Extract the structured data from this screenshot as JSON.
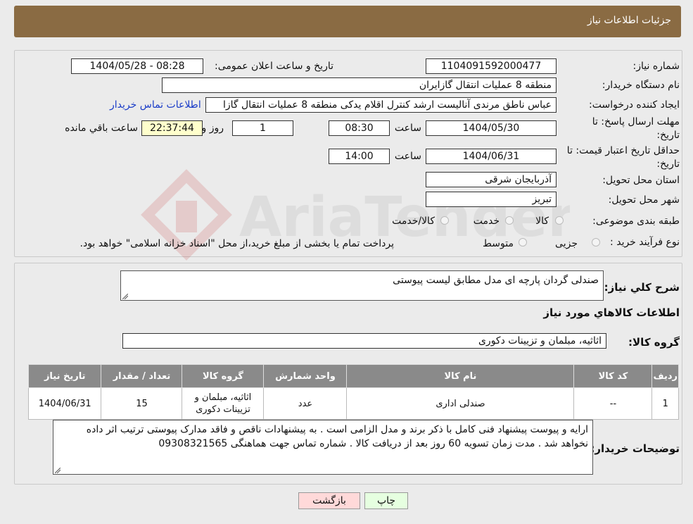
{
  "header": {
    "title": "جزئیات اطلاعات نیاز"
  },
  "fields": {
    "need_number_label": "شماره نیاز:",
    "need_number": "1104091592000477",
    "announce_label": "تاریخ و ساعت اعلان عمومی:",
    "announce_value": "1404/05/28 - 08:28",
    "buyer_org_label": "نام دستگاه خریدار:",
    "buyer_org": "منطقه 8 عملیات انتقال گازایران",
    "creator_label": "ایجاد کننده درخواست:",
    "creator": "عباس ناطق مرندی آنالیست ارشد کنترل اقلام یدکی منطقه 8 عملیات انتقال گازا",
    "contact_link": "اطلاعات تماس خریدار",
    "deadline_label_1": "مهلت ارسال پاسخ: تا",
    "deadline_label_2": "تاریخ:",
    "deadline_date": "1404/05/30",
    "time_word": "ساعت",
    "deadline_time": "08:30",
    "days_value": "1",
    "days_word": "روز و",
    "remaining_time": "22:37:44",
    "remaining_word": "ساعت باقي مانده",
    "validity_label_1": "حداقل تاریخ اعتبار قیمت: تا",
    "validity_label_2": "تاریخ:",
    "validity_date": "1404/06/31",
    "validity_time": "14:00",
    "province_label": "استان محل تحویل:",
    "province": "آذربایجان شرقی",
    "city_label": "شهر محل تحویل:",
    "city": "تبریز",
    "category_label": "طبقه بندی موضوعی:",
    "category_options": [
      "کالا",
      "خدمت",
      "کالا/خدمت"
    ],
    "process_label": "نوع فرآیند خرید :",
    "process_options": [
      "جزیی",
      "متوسط"
    ],
    "process_note": "پرداخت تمام یا بخشی از مبلغ خرید،از محل \"اسناد خزانه اسلامی\" خواهد بود."
  },
  "summary": {
    "label": "شرح کلي نیاز:",
    "value": "صندلی گردان پارچه ای مدل مطابق لیست پیوستی",
    "items_heading": "اطلاعات کالاهاي مورد نیاز",
    "group_label": "گروه کالا:",
    "group_value": "اثاثیه، مبلمان و تزیینات دکوری"
  },
  "table": {
    "headers": [
      "ردیف",
      "کد کالا",
      "نام کالا",
      "واحد شمارش",
      "گروه کالا",
      "تعداد / مقدار",
      "تاریخ نیاز"
    ],
    "rows": [
      [
        "1",
        "--",
        "صندلی اداری",
        "عدد",
        "اثاثیه، مبلمان و تزیینات دکوری",
        "15",
        "1404/06/31"
      ]
    ]
  },
  "buyer_notes": {
    "label": "توضیحات خریدار:",
    "text": "ارایه و پیوست پیشنهاد فنی کامل با ذکر برند و مدل الزامی است . به پیشنهادات ناقص و فاقد مدارک پیوستی ترتیب اثر داده نخواهد شد . مدت زمان تسویه 60 روز بعد از دریافت کالا . شماره تماس جهت هماهنگی 09308321565"
  },
  "buttons": {
    "print": "چاپ",
    "back": "بازگشت"
  },
  "watermark": {
    "text": "AriaTender.neT"
  },
  "colors": {
    "header_bg": "#8a6b43",
    "table_header_bg": "#8a8a8a",
    "back_button_bg": "#ffd9d9",
    "print_button_bg": "#e6ffe0",
    "link": "#1a3cc8"
  }
}
